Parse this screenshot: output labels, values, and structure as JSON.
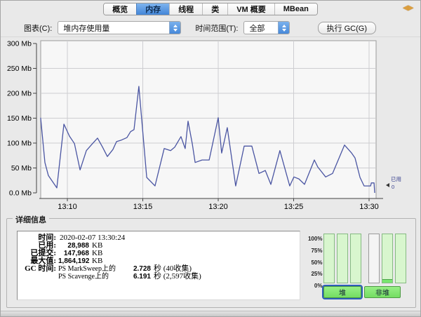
{
  "tabs": [
    {
      "label": "概览",
      "selected": false
    },
    {
      "label": "内存",
      "selected": true
    },
    {
      "label": "线程",
      "selected": false
    },
    {
      "label": "类",
      "selected": false
    },
    {
      "label": "VM 概要",
      "selected": false
    },
    {
      "label": "MBean",
      "selected": false
    }
  ],
  "window_icon": {
    "name": "connect-arrows-icon",
    "glyphs": "◀▶"
  },
  "toolbar": {
    "chart_label": "图表(C):",
    "chart_value": "堆内存使用量",
    "range_label": "时间范围(T):",
    "range_value": "全部",
    "gc_button": "执行 GC(G)"
  },
  "chart_data": {
    "type": "line",
    "title": "堆内存使用量",
    "ylabel": "Mb",
    "ylim": [
      0,
      300
    ],
    "xlim_minutes": [
      8.23,
      30.5
    ],
    "grid": true,
    "legend_position": "right",
    "legend": {
      "label": "已用",
      "value": "0"
    },
    "y_ticks": [
      {
        "mb": 300,
        "label": "300 Mb"
      },
      {
        "mb": 250,
        "label": "250 Mb"
      },
      {
        "mb": 200,
        "label": "200 Mb"
      },
      {
        "mb": 150,
        "label": "150 Mb"
      },
      {
        "mb": 100,
        "label": "100 Mb"
      },
      {
        "mb": 50,
        "label": "50 Mb"
      },
      {
        "mb": 0,
        "label": "0.0 Mb"
      }
    ],
    "x_ticks": [
      {
        "m": 10,
        "label": "13:10"
      },
      {
        "m": 15,
        "label": "13:15"
      },
      {
        "m": 20,
        "label": "13:20"
      },
      {
        "m": 25,
        "label": "13:25"
      },
      {
        "m": 30,
        "label": "13:30"
      }
    ],
    "h_gridlines_mb": [
      50,
      100,
      150,
      200,
      250
    ],
    "series": [
      {
        "name": "已用",
        "color": "#4a55a2",
        "points_min_mb": [
          [
            8.23,
            151
          ],
          [
            8.51,
            61
          ],
          [
            8.74,
            35
          ],
          [
            9.3,
            10
          ],
          [
            9.77,
            138
          ],
          [
            10.14,
            114
          ],
          [
            10.47,
            99
          ],
          [
            10.84,
            46
          ],
          [
            11.26,
            85
          ],
          [
            11.67,
            99
          ],
          [
            12.0,
            110
          ],
          [
            12.33,
            92
          ],
          [
            12.65,
            73
          ],
          [
            13.02,
            87
          ],
          [
            13.26,
            103
          ],
          [
            13.58,
            106
          ],
          [
            13.95,
            111
          ],
          [
            14.19,
            123
          ],
          [
            14.42,
            127
          ],
          [
            14.74,
            214
          ],
          [
            15.26,
            31
          ],
          [
            15.49,
            24
          ],
          [
            15.81,
            14
          ],
          [
            16.42,
            89
          ],
          [
            16.84,
            85
          ],
          [
            17.12,
            92
          ],
          [
            17.53,
            113
          ],
          [
            17.81,
            89
          ],
          [
            18.0,
            144
          ],
          [
            18.28,
            99
          ],
          [
            18.47,
            61
          ],
          [
            18.93,
            66
          ],
          [
            19.4,
            66
          ],
          [
            20.0,
            151
          ],
          [
            20.23,
            80
          ],
          [
            20.6,
            131
          ],
          [
            21.16,
            14
          ],
          [
            21.72,
            94
          ],
          [
            22.23,
            94
          ],
          [
            22.7,
            39
          ],
          [
            23.12,
            45
          ],
          [
            23.49,
            17
          ],
          [
            24.09,
            85
          ],
          [
            24.74,
            14
          ],
          [
            25.02,
            32
          ],
          [
            25.35,
            28
          ],
          [
            25.72,
            17
          ],
          [
            26.37,
            66
          ],
          [
            26.6,
            52
          ],
          [
            27.12,
            32
          ],
          [
            27.58,
            39
          ],
          [
            28.37,
            96
          ],
          [
            28.84,
            80
          ],
          [
            29.07,
            70
          ],
          [
            29.4,
            31
          ],
          [
            29.67,
            14
          ],
          [
            30.1,
            14
          ],
          [
            30.15,
            20
          ],
          [
            30.33,
            20
          ],
          [
            30.37,
            0
          ]
        ]
      }
    ]
  },
  "details": {
    "title": "详细信息",
    "rows": [
      {
        "label": "时间:",
        "text": "2020-02-07 13:30:24"
      },
      {
        "label": "已用:",
        "num": "28,988",
        "unit": "KB"
      },
      {
        "label": "已提交:",
        "num": "147,968",
        "unit": "KB"
      },
      {
        "label": "最大值:",
        "num": "1,864,192",
        "unit": "KB"
      },
      {
        "label": "GC 时间:",
        "pool": "PS MarkSweep上的",
        "num": "2.728",
        "unit": "秒 (40收集)"
      },
      {
        "label": "",
        "pool": "PS Scavenge上的",
        "num": "6.191",
        "unit": "秒 (2,597收集)"
      }
    ]
  },
  "gauges": {
    "scale": [
      "100% --",
      "75% --",
      "50% --",
      "25% --",
      "0% --"
    ],
    "bars": [
      {
        "group": "heap",
        "filled": true,
        "usage_pct": 0
      },
      {
        "group": "heap",
        "filled": true,
        "usage_pct": 0
      },
      {
        "group": "heap",
        "filled": true,
        "usage_pct": 0
      },
      {
        "group": "nonheap",
        "filled": false,
        "usage_pct": 0
      },
      {
        "group": "nonheap",
        "filled": true,
        "usage_pct": 7
      },
      {
        "group": "nonheap",
        "filled": true,
        "usage_pct": 0
      }
    ],
    "buttons": [
      {
        "label": "堆",
        "focused": true
      },
      {
        "label": "非堆",
        "focused": false
      }
    ]
  },
  "colors": {
    "accent_blue": "#4f92e4",
    "tab_selected": "#5b9ce6",
    "line_series": "#4a55a2",
    "legend_text": "#39418f",
    "bar_fill": "#d8f6ce",
    "bar_usage": "#79e670",
    "button_green": "#85e978",
    "icon_orange": "#dd9f3e"
  }
}
